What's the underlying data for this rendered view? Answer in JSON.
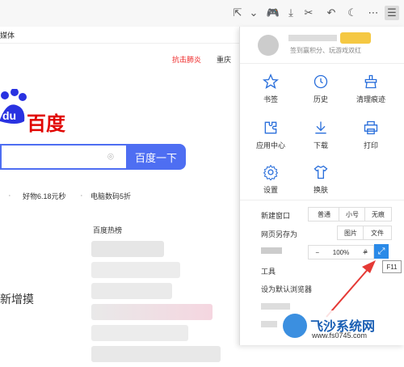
{
  "toolbar": {
    "menu_icon": "hamburger-menu-icon"
  },
  "bookmarks": {
    "first": "媒体"
  },
  "page": {
    "news_link": "抗击肺炎",
    "city": "重庆",
    "logo_text": "百度",
    "search_button": "百度一下",
    "suggestions": [
      "好物6.18元秒",
      "电脑数码5折"
    ],
    "hot_title": "百度热榜",
    "side_text": "新增摸"
  },
  "menu": {
    "user_subtitle": "签到赢积分、玩游戏双红",
    "grid": [
      {
        "label": "书签",
        "icon": "star-icon"
      },
      {
        "label": "历史",
        "icon": "clock-icon"
      },
      {
        "label": "清理痕迹",
        "icon": "broom-icon"
      },
      {
        "label": "应用中心",
        "icon": "puzzle-icon"
      },
      {
        "label": "下载",
        "icon": "download-icon"
      },
      {
        "label": "打印",
        "icon": "printer-icon"
      },
      {
        "label": "设置",
        "icon": "gear-icon"
      },
      {
        "label": "换肤",
        "icon": "shirt-icon"
      }
    ],
    "new_window": {
      "label": "新建窗口",
      "options": [
        "普通",
        "小号",
        "无痕"
      ]
    },
    "save_as": {
      "label": "网页另存为",
      "options": [
        "图片",
        "文件"
      ]
    },
    "zoom": {
      "minus": "−",
      "value": "100%",
      "plus": "+"
    },
    "tools": "工具",
    "default_browser": "设为默认浏览器",
    "tooltip": "F11"
  },
  "watermark": {
    "text": "飞沙系统网",
    "url": "www.fs0745.com"
  }
}
